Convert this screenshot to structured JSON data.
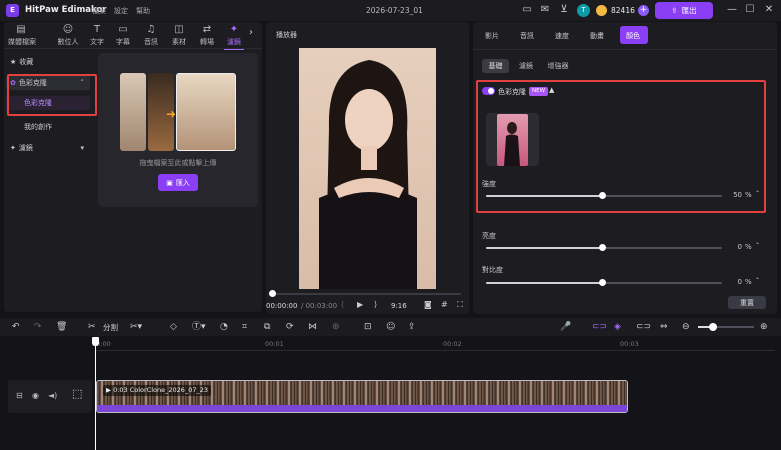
{
  "app": {
    "name": "HitPaw Edimakor",
    "logo_text": "E"
  },
  "menu": [
    "檔案",
    "設定",
    "幫助"
  ],
  "document_title": "2026-07-23_01",
  "account": {
    "avatar_letter": "T",
    "credits": "82416",
    "export_label": "匯出"
  },
  "top_tabs": [
    {
      "label": "媒體檔案",
      "icon": "media-icon"
    },
    {
      "label": "數位人",
      "icon": "avatar-person-icon"
    },
    {
      "label": "文字",
      "icon": "text-icon"
    },
    {
      "label": "字幕",
      "icon": "subtitle-icon"
    },
    {
      "label": "音訊",
      "icon": "music-note-icon"
    },
    {
      "label": "素材",
      "icon": "assets-icon"
    },
    {
      "label": "轉場",
      "icon": "transition-icon"
    },
    {
      "label": "濾鏡",
      "icon": "filter-sparkle-icon",
      "active": true
    }
  ],
  "sidebar": {
    "favorites": "收藏",
    "color_clone_group": "色彩克隆",
    "color_clone_item": "色彩克隆",
    "my_creations": "我的創作",
    "filters": "濾鏡"
  },
  "import_card": {
    "drop_text": "拖曳檔案至此或點擊上傳",
    "import_label": "匯入"
  },
  "player": {
    "title": "播放器",
    "current_time": "00:00:00",
    "total_time": "/ 00:03:00",
    "aspect": "9:16"
  },
  "inspector": {
    "tabs": [
      "影片",
      "音訊",
      "速度",
      "動畫",
      "顏色"
    ],
    "active_tab": "顏色",
    "subtabs": [
      "基礎",
      "濾鏡",
      "增強器"
    ],
    "color_clone": {
      "label": "色彩克隆",
      "badge": "NEW",
      "enabled": true
    },
    "sliders": [
      {
        "key": "strength",
        "label": "強度",
        "value": 50,
        "display": "50",
        "unit": "%"
      },
      {
        "key": "brightness",
        "label": "亮度",
        "value": 0,
        "display": "0",
        "unit": "%"
      },
      {
        "key": "contrast",
        "label": "對比度",
        "value": 0,
        "display": "0",
        "unit": "%"
      }
    ],
    "reset_label": "重置"
  },
  "toolbar": {
    "split_label": "分割"
  },
  "timeline": {
    "ruler": [
      "00:00",
      "00:01",
      "00:02",
      "00:03"
    ],
    "clip_label": "0:03 ColorClone_2026_07_23"
  },
  "colors": {
    "accent": "#8b3ff5",
    "highlight_box": "#e34040",
    "clip_bar": "#7b45d8"
  }
}
